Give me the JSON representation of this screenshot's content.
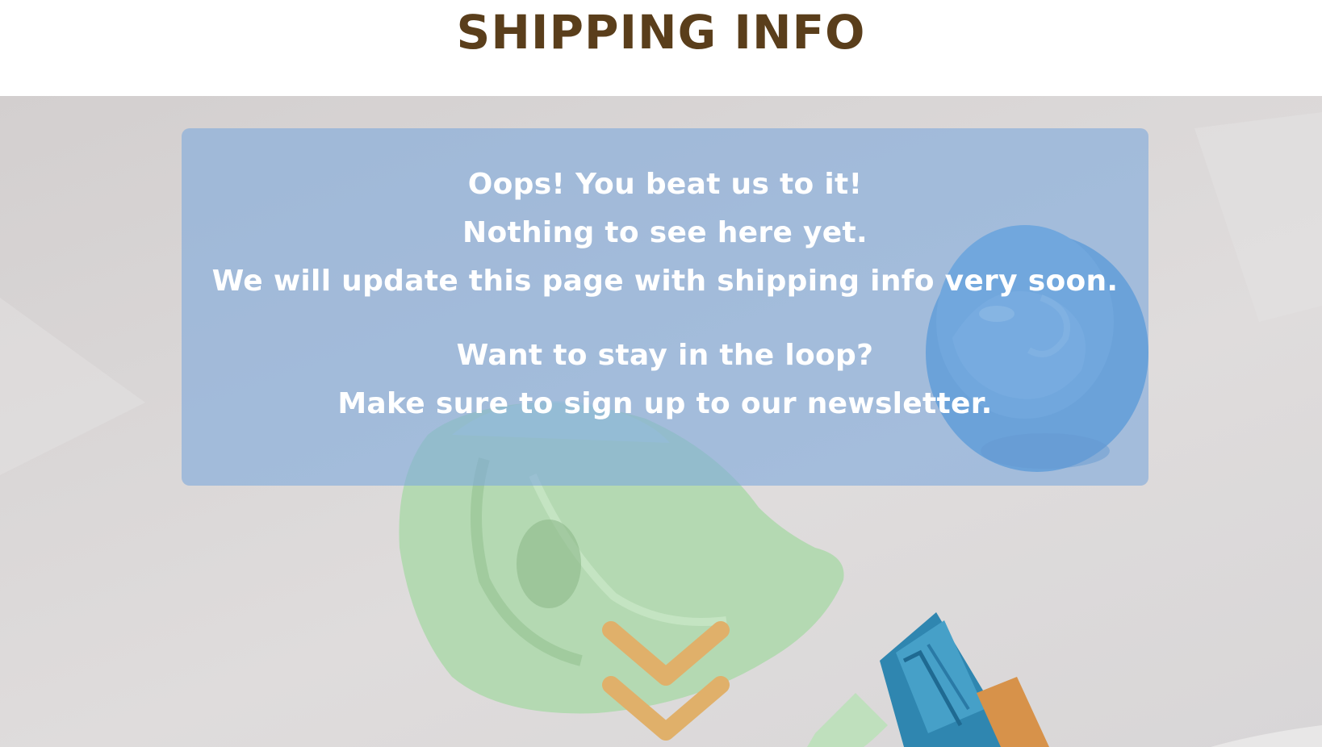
{
  "header": {
    "title": "SHIPPING INFO"
  },
  "message": {
    "lines_1": [
      "Oops! You beat us to it!",
      "Nothing to see here yet.",
      "We will update this page with shipping info very soon."
    ],
    "lines_2": [
      "Want to stay in the loop?",
      "Make sure to sign up to our newsletter."
    ]
  },
  "scroll": {
    "icon": "double-chevron-down-icon"
  },
  "colors": {
    "title": "#5a3e1b",
    "card": "#80aadc",
    "chevron": "#e0b06a",
    "text": "#ffffff"
  }
}
